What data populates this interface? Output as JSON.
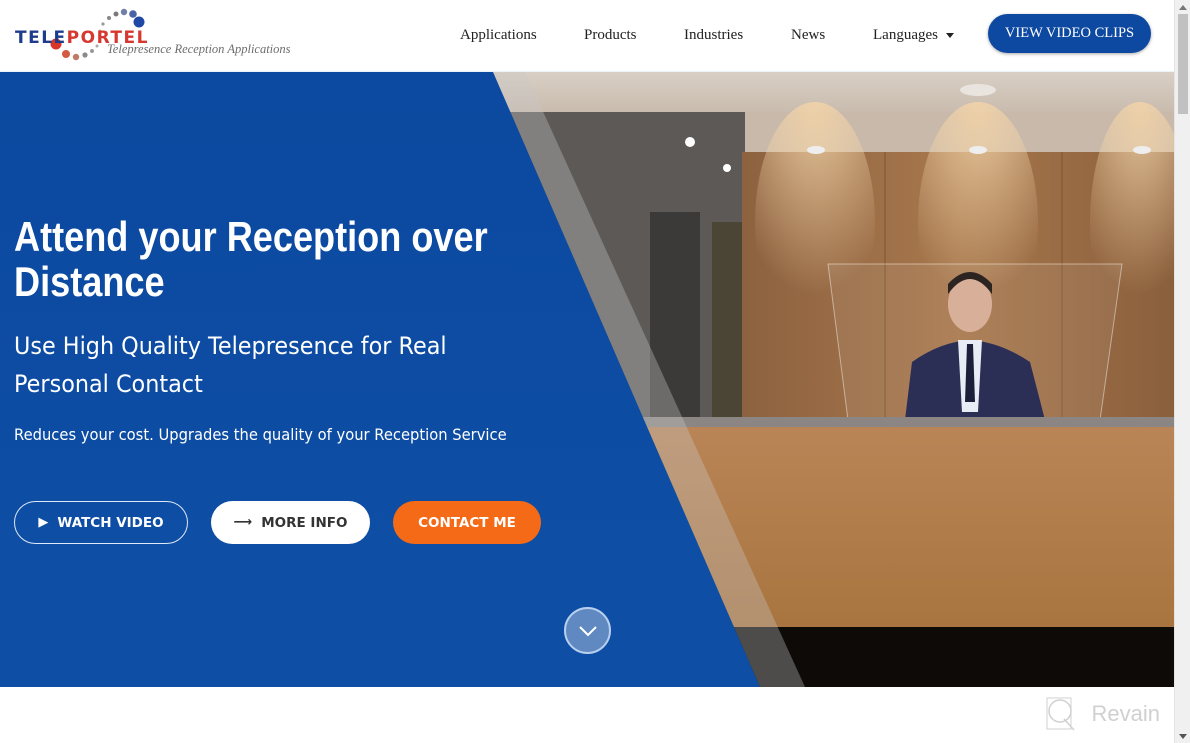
{
  "header": {
    "logo": {
      "word_part1": "TELE",
      "word_part2": "PORTEL",
      "tagline": "Telepresence Reception Applications"
    },
    "nav": [
      {
        "label": "Applications"
      },
      {
        "label": "Products"
      },
      {
        "label": "Industries"
      },
      {
        "label": "News"
      },
      {
        "label": "Languages",
        "has_dropdown": true
      }
    ],
    "cta_label": "VIEW VIDEO CLIPS"
  },
  "hero": {
    "title_line1": "Attend your Reception over",
    "title_line2": "Distance",
    "subtitle": "Use High Quality Telepresence for Real Personal Contact",
    "description": "Reduces your cost. Upgrades the quality of your Reception Service",
    "buttons": {
      "watch_video": {
        "label": "WATCH VIDEO",
        "icon": "play-icon"
      },
      "more_info": {
        "label": "MORE INFO",
        "icon": "arrow-right-icon"
      },
      "contact_me": {
        "label": "CONTACT ME"
      }
    },
    "scroll_down_icon": "chevron-down-icon",
    "image_description": "Virtual receptionist in suit standing behind wooden reception desk with spotlights"
  },
  "watermark": {
    "label": "Revain"
  },
  "colors": {
    "brand_blue": "#0d48a1",
    "hero_blue": "#0e4da3",
    "accent_orange": "#f56a16",
    "logo_red": "#d6372e",
    "logo_navy": "#1d3c8c"
  }
}
